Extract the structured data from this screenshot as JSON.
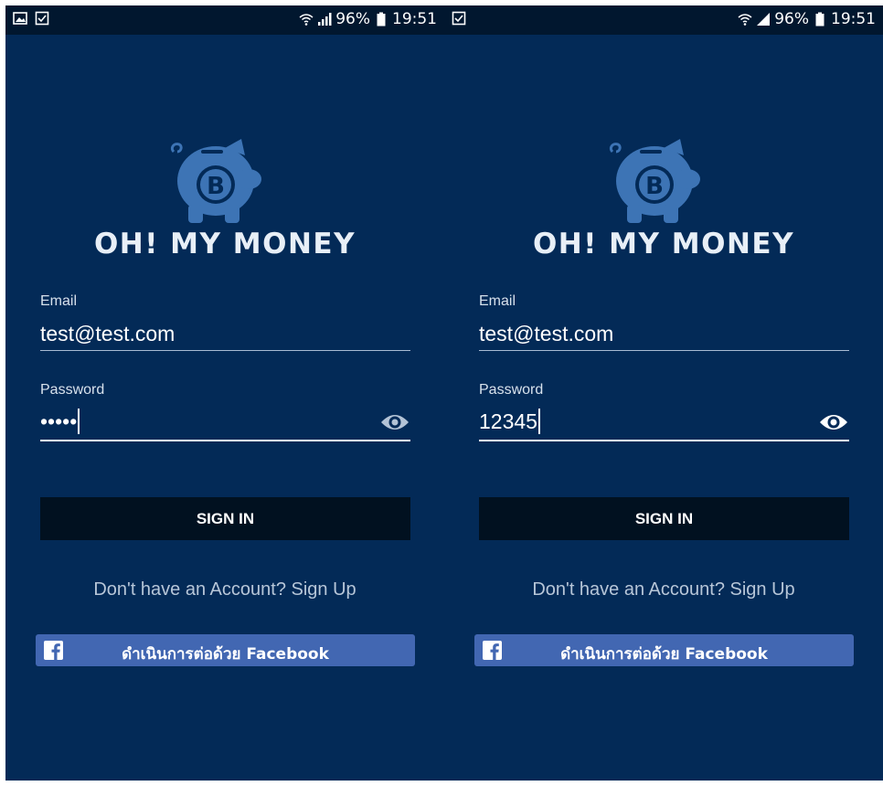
{
  "screens": [
    {
      "status": {
        "battery": "96%",
        "time": "19:51"
      },
      "app_name": "OH! MY MONEY",
      "email": {
        "label": "Email",
        "value": "test@test.com"
      },
      "password": {
        "label": "Password",
        "value": "•••••",
        "visible": false
      },
      "signin_label": "SIGN IN",
      "signup": {
        "prompt": "Don't have an Account?",
        "link": "Sign Up"
      },
      "facebook_label": "ดำเนินการต่อด้วย Facebook"
    },
    {
      "status": {
        "battery": "96%",
        "time": "19:51"
      },
      "app_name": "OH! MY MONEY",
      "email": {
        "label": "Email",
        "value": "test@test.com"
      },
      "password": {
        "label": "Password",
        "value": "12345",
        "visible": true
      },
      "signin_label": "SIGN IN",
      "signup": {
        "prompt": "Don't have an Account?",
        "link": "Sign Up"
      },
      "facebook_label": "ดำเนินการต่อด้วย Facebook"
    }
  ],
  "colors": {
    "background": "#032a57",
    "status_bar": "#01172f",
    "logo": "#3d74b5",
    "button": "#011120",
    "facebook": "#4267b2"
  },
  "icons": [
    "gallery-icon",
    "checkbox-icon",
    "wifi-icon",
    "signal-icon",
    "battery-icon",
    "piggy-bank-bitcoin-icon",
    "eye-icon",
    "facebook-icon"
  ]
}
